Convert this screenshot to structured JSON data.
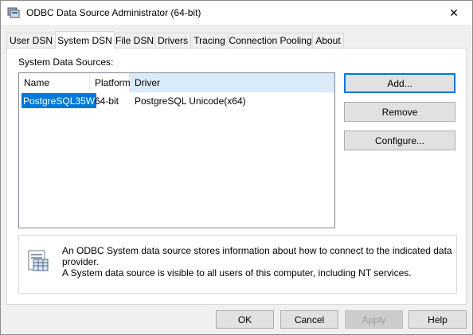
{
  "window": {
    "title": "ODBC Data Source Administrator (64-bit)",
    "close_glyph": "✕"
  },
  "tabs": [
    "User DSN",
    "System DSN",
    "File DSN",
    "Drivers",
    "Tracing",
    "Connection Pooling",
    "About"
  ],
  "active_tab": "System DSN",
  "system_dsn": {
    "group_label": "System Data Sources:",
    "columns": [
      "Name",
      "Platform",
      "Driver"
    ],
    "rows": [
      {
        "name": "PostgreSQL35W",
        "platform": "64-bit",
        "driver": "PostgreSQL Unicode(x64)"
      }
    ],
    "buttons": {
      "add": "Add...",
      "remove": "Remove",
      "configure": "Configure..."
    },
    "info": {
      "line1": "An ODBC System data source stores information about how to connect to the indicated data provider.",
      "line2": "A System data source is visible to all users of this computer, including NT services."
    }
  },
  "footer": {
    "ok": "OK",
    "cancel": "Cancel",
    "apply": "Apply",
    "help": "Help"
  },
  "colors": {
    "selection": "#0078d7",
    "header_sorted": "#d9ebf9",
    "default_button_border": "#0078d7"
  }
}
